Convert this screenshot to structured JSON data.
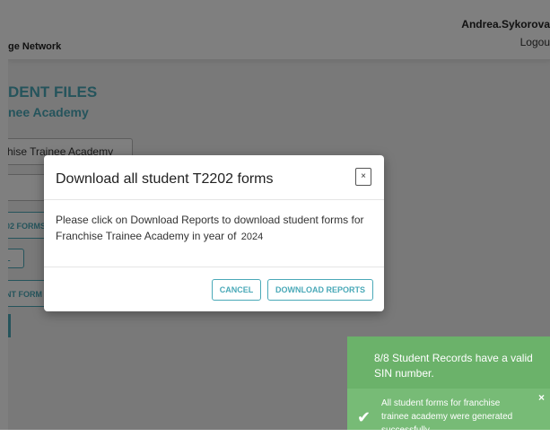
{
  "header": {
    "brand": "ge Network",
    "user_name": "Andrea.Sykorova",
    "logout_label": "Logou"
  },
  "main": {
    "title": "DENT FILES",
    "subtitle": "nee Academy",
    "school_select_value": "hise Trainee Academy",
    "btn_t2202_forms": "02 FORMS",
    "btn_small": "L",
    "btn_student_forms": "NT FORM"
  },
  "modal": {
    "title": "Download all student T2202 forms",
    "close_label": "×",
    "body_text": "Please click on Download Reports to download student forms for Franchise Trainee Academy in year of",
    "year": "2024",
    "cancel_label": "CANCEL",
    "download_label": "DOWNLOAD REPORTS"
  },
  "toast": {
    "line1": "8/8 Student Records have a valid SIN number.",
    "line2": "All student forms for franchise trainee academy were generated successfully",
    "check_icon": "✔",
    "close_label": "×"
  },
  "colors": {
    "accent": "#4aa9b8",
    "toast_green": "#6bb26a",
    "overlay": "rgba(0,0,0,0.5)"
  }
}
